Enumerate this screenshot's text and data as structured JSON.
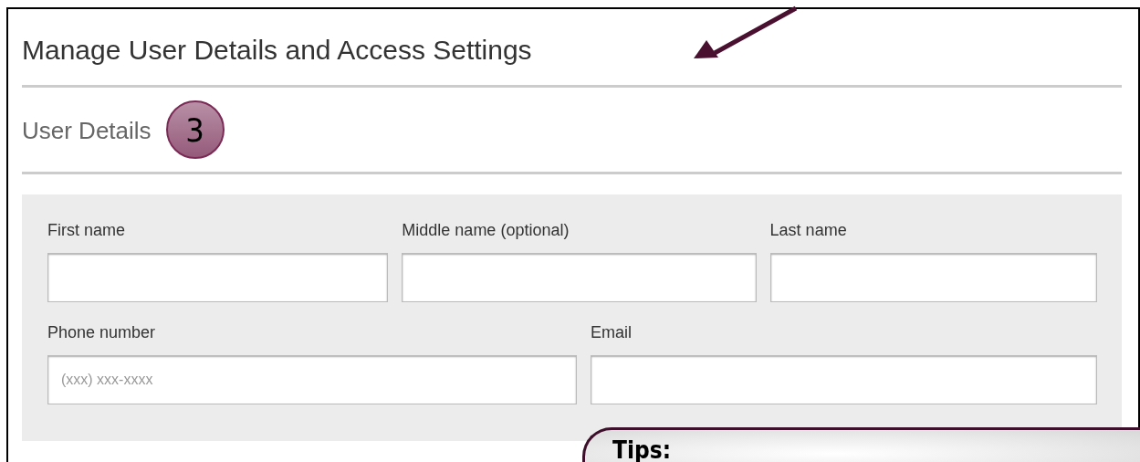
{
  "title": "Manage User Details and Access Settings",
  "section": {
    "heading": "User Details",
    "step_badge": "3"
  },
  "field_rows": [
    [
      {
        "label": "First name"
      },
      {
        "label": "Middle name (optional)"
      },
      {
        "label": "Last name"
      }
    ],
    [
      {
        "label": "Phone number",
        "placeholder": "(xxx) xxx-xxxx"
      },
      {
        "label": "Email"
      }
    ]
  ],
  "callout": {
    "title": "Tips:"
  }
}
